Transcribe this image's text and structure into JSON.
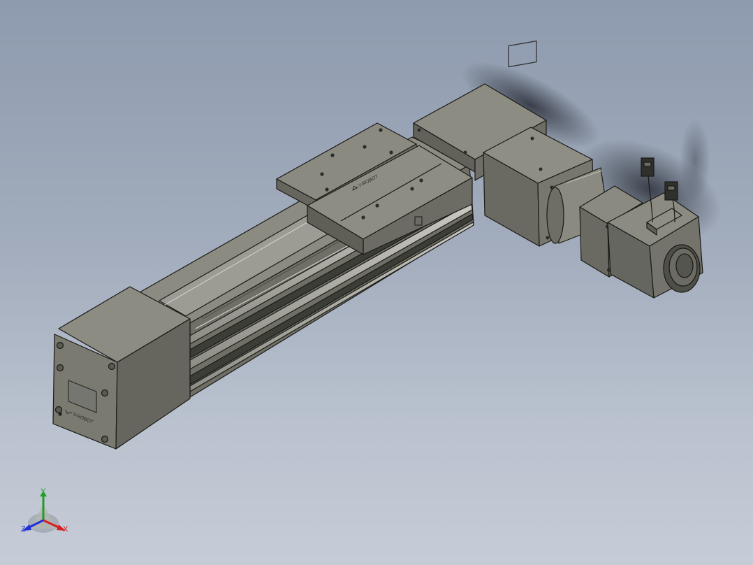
{
  "viewport": {
    "background_top": "#8e9aae",
    "background_bottom": "#c6ccd7"
  },
  "model": {
    "body_color": "#75756b",
    "body_dark": "#5e5e55",
    "body_light": "#8e8e84",
    "edge_color": "#1a1a16",
    "brand_mark": "Y-ROBOT"
  },
  "triad": {
    "x_label": "X",
    "y_label": "Y",
    "z_label": "Z",
    "x_color": "#d62020",
    "y_color": "#1e9e2a",
    "z_color": "#1f2fd8"
  }
}
